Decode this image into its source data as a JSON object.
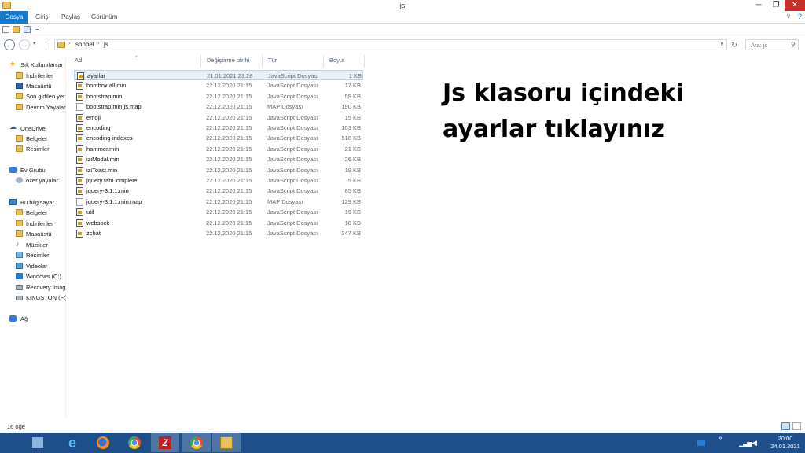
{
  "window": {
    "title": "js",
    "min_glyph": "─",
    "max_glyph": "❐",
    "close_glyph": "✕"
  },
  "ribbon": {
    "tabs": [
      "Dosya",
      "Giriş",
      "Paylaş",
      "Görünüm"
    ],
    "help_glyph": "?",
    "collapse_glyph": "∨"
  },
  "quick_access": {
    "dropdown_glyph": "="
  },
  "navigation": {
    "back_glyph": "←",
    "forward_glyph": "→",
    "recent_glyph": "▾",
    "up_glyph": "↑",
    "breadcrumb": [
      "sohbet",
      "js"
    ],
    "separator_glyph": "›",
    "dropdown_glyph": "∨",
    "refresh_glyph": "↻",
    "search_placeholder": "Ara: js",
    "search_glyph": "⚲"
  },
  "sidebar": {
    "favorites_label": "Sık Kullanılanlar",
    "favorites": [
      "İndirilenler",
      "Masaüstü",
      "Son gidilen yer",
      "Devrim Yayalar"
    ],
    "onedrive_label": "OneDrive",
    "onedrive": [
      "Belgeler",
      "Resimler"
    ],
    "homegroup_label": "Ev Grubu",
    "homegroup": [
      "ozer yayalar"
    ],
    "computer_label": "Bu bilgisayar",
    "computer": [
      "Belgeler",
      "İndirilenler",
      "Masaüstü",
      "Müzikler",
      "Resimler",
      "Videolar",
      "Windows (C:)",
      "Recovery Imag",
      "KINGSTON (F:)"
    ],
    "network_label": "Ağ",
    "star_glyph": "★",
    "cloud_glyph": "☁",
    "music_glyph": "♪"
  },
  "columns": {
    "name": "Ad",
    "date": "Değiştirme tarihi",
    "type": "Tür",
    "size": "Boyut",
    "sort_glyph": "^"
  },
  "files": [
    {
      "name": "ayarlar",
      "date": "21.01.2021 23:28",
      "type": "JavaScript Dosyası",
      "size": "1 KB",
      "icon": "js-file-icon",
      "selected": true
    },
    {
      "name": "bootbox.all.min",
      "date": "22.12.2020 21:15",
      "type": "JavaScript Dosyası",
      "size": "17 KB",
      "icon": "js-file-icon"
    },
    {
      "name": "bootstrap.min",
      "date": "22.12.2020 21:15",
      "type": "JavaScript Dosyası",
      "size": "59 KB",
      "icon": "js-file-icon"
    },
    {
      "name": "bootstrap.min.js.map",
      "date": "22.12.2020 21:15",
      "type": "MAP Dosyası",
      "size": "190 KB",
      "icon": "map-file-icon"
    },
    {
      "name": "emoji",
      "date": "22.12.2020 21:15",
      "type": "JavaScript Dosyası",
      "size": "15 KB",
      "icon": "js-file-icon"
    },
    {
      "name": "encoding",
      "date": "22.12.2020 21:15",
      "type": "JavaScript Dosyası",
      "size": "103 KB",
      "icon": "js-file-icon"
    },
    {
      "name": "encoding-indexes",
      "date": "22.12.2020 21:15",
      "type": "JavaScript Dosyası",
      "size": "518 KB",
      "icon": "js-file-icon"
    },
    {
      "name": "hammer.min",
      "date": "22.12.2020 21:15",
      "type": "JavaScript Dosyası",
      "size": "21 KB",
      "icon": "js-file-icon"
    },
    {
      "name": "iziModal.min",
      "date": "22.12.2020 21:15",
      "type": "JavaScript Dosyası",
      "size": "26 KB",
      "icon": "js-file-icon"
    },
    {
      "name": "iziToast.min",
      "date": "22.12.2020 21:15",
      "type": "JavaScript Dosyası",
      "size": "19 KB",
      "icon": "js-file-icon"
    },
    {
      "name": "jquery.tabComplete",
      "date": "22.12.2020 21:15",
      "type": "JavaScript Dosyası",
      "size": "5 KB",
      "icon": "js-file-icon"
    },
    {
      "name": "jquery-3.1.1.min",
      "date": "22.12.2020 21:15",
      "type": "JavaScript Dosyası",
      "size": "85 KB",
      "icon": "js-file-icon"
    },
    {
      "name": "jquery-3.1.1.min.map",
      "date": "22.12.2020 21:15",
      "type": "MAP Dosyası",
      "size": "129 KB",
      "icon": "map-file-icon"
    },
    {
      "name": "util",
      "date": "22.12.2020 21:15",
      "type": "JavaScript Dosyası",
      "size": "19 KB",
      "icon": "js-file-icon"
    },
    {
      "name": "websock",
      "date": "22.12.2020 21:15",
      "type": "JavaScript Dosyası",
      "size": "18 KB",
      "icon": "js-file-icon"
    },
    {
      "name": "zchat",
      "date": "22.12.2020 21:15",
      "type": "JavaScript Dosyası",
      "size": "347 KB",
      "icon": "js-file-icon"
    }
  ],
  "annotation": {
    "line1": "Js klasoru içindeki",
    "line2": "ayarlar tıklayınız"
  },
  "status": {
    "item_count": "16 öğe"
  },
  "taskbar": {
    "ie_glyph": "e",
    "filezilla_glyph": "Z",
    "tray_chevron": "»",
    "signal_glyph": "▁▃▅",
    "volume_glyph": "◀",
    "time": "20:00",
    "date": "24.01.2021"
  },
  "colors": {
    "accent": "#1979ca",
    "taskbar": "#1e4f8a",
    "selection": "#e5f1fb",
    "close": "#c7302b"
  }
}
